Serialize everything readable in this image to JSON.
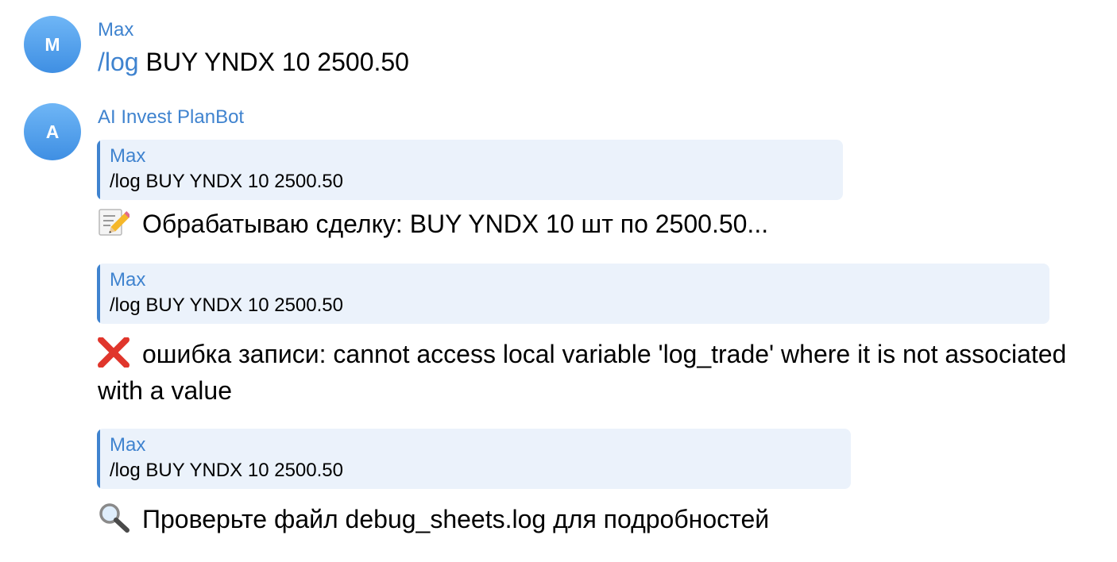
{
  "messages": {
    "user": {
      "avatar_letter": "M",
      "sender": "Max",
      "command": "/log",
      "args": " BUY YNDX 10 2500.50"
    },
    "bot": {
      "avatar_letter": "A",
      "sender": "AI Invest PlanBot",
      "replies": [
        {
          "quote_name": "Max",
          "quote_text": "/log BUY YNDX 10 2500.50",
          "icon": "memo-icon",
          "text": "Обрабатываю сделку: BUY YNDX 10 шт по 2500.50..."
        },
        {
          "quote_name": "Max",
          "quote_text": "/log BUY YNDX 10 2500.50",
          "icon": "cross-mark-icon",
          "text": "ошибка записи: cannot access local variable 'log_trade' where it is not associated with a value"
        },
        {
          "quote_name": "Max",
          "quote_text": "/log BUY YNDX 10 2500.50",
          "icon": "magnifier-icon",
          "text": "Проверьте файл debug_sheets.log для подробностей"
        }
      ]
    }
  },
  "colors": {
    "accent": "#3f83cf",
    "quote_bg": "#ebf2fb",
    "avatar_top": "#6fb6f6",
    "avatar_bottom": "#3f8fe3",
    "error_red": "#e0362c"
  }
}
